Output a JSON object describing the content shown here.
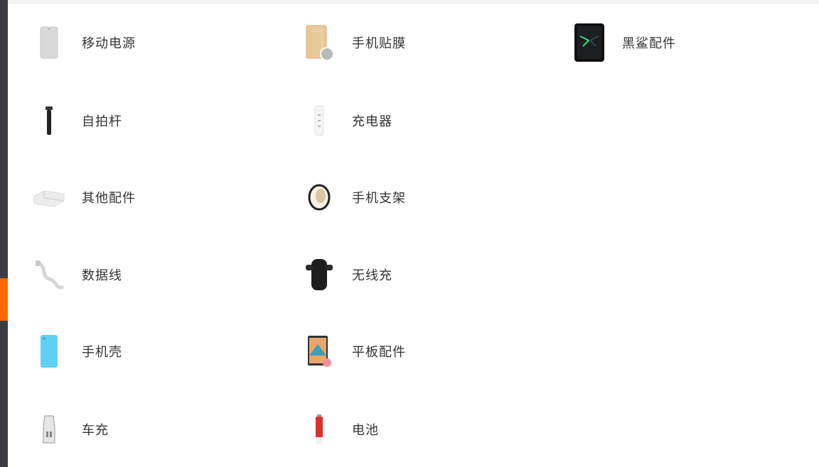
{
  "categories": {
    "col1": [
      {
        "label": "移动电源",
        "icon": "power-bank-icon"
      },
      {
        "label": "自拍杆",
        "icon": "selfie-stick-icon"
      },
      {
        "label": "其他配件",
        "icon": "accessories-icon"
      },
      {
        "label": "数据线",
        "icon": "data-cable-icon"
      },
      {
        "label": "手机壳",
        "icon": "phone-case-icon"
      },
      {
        "label": "车充",
        "icon": "car-charger-icon"
      }
    ],
    "col2": [
      {
        "label": "手机贴膜",
        "icon": "screen-protector-icon"
      },
      {
        "label": "充电器",
        "icon": "charger-icon"
      },
      {
        "label": "手机支架",
        "icon": "phone-holder-ring-icon"
      },
      {
        "label": "无线充",
        "icon": "wireless-charger-icon"
      },
      {
        "label": "平板配件",
        "icon": "tablet-accessory-icon"
      },
      {
        "label": "电池",
        "icon": "battery-icon"
      }
    ],
    "col3": [
      {
        "label": "黑鲨配件",
        "icon": "black-shark-phone-icon"
      }
    ]
  },
  "colors": {
    "accent": "#ff6700",
    "sidebar": "#3b3d42",
    "text": "#333333"
  }
}
